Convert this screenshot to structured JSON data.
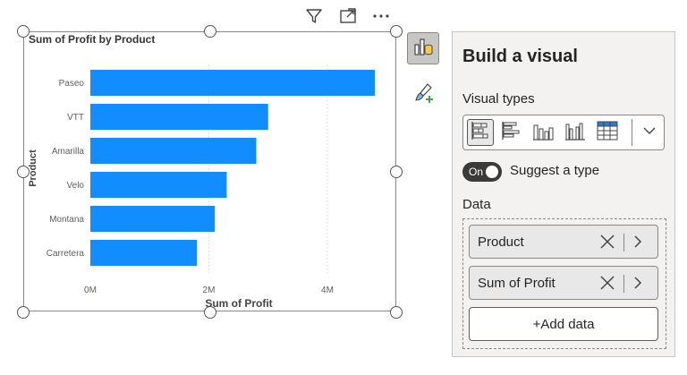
{
  "visual": {
    "title": "Sum of Profit by Product",
    "header_icons": [
      "filter-icon",
      "focus-mode-icon",
      "more-options-icon"
    ]
  },
  "chart_data": {
    "type": "bar",
    "orientation": "horizontal",
    "title": "Sum of Profit by Product",
    "categories": [
      "Paseo",
      "VTT",
      "Amarilla",
      "Velo",
      "Montana",
      "Carretera"
    ],
    "values": [
      4.8,
      3.0,
      2.8,
      2.3,
      2.1,
      1.8
    ],
    "value_unit": "M",
    "xlabel": "Sum of Profit",
    "ylabel": "Product",
    "xticks": [
      "0M",
      "2M",
      "4M"
    ],
    "xlim": [
      0,
      5.5
    ],
    "grid": true,
    "bar_color": "#118DFF"
  },
  "side_buttons": {
    "build_visual": "build-visual-icon",
    "format_visual": "format-visual-icon"
  },
  "panel": {
    "title": "Build a visual",
    "visual_types_label": "Visual types",
    "visual_types": [
      "stacked-bar-chart-icon",
      "clustered-bar-chart-icon",
      "stacked-column-chart-icon",
      "clustered-column-chart-icon",
      "table-icon"
    ],
    "toggle_state": "On",
    "suggest_label": "Suggest a type",
    "data_label": "Data",
    "fields": [
      "Product",
      "Sum of Profit"
    ],
    "add_data": "+Add data"
  },
  "colors": {
    "accent": "#118DFF",
    "panel_bg": "#f3f2f1"
  }
}
